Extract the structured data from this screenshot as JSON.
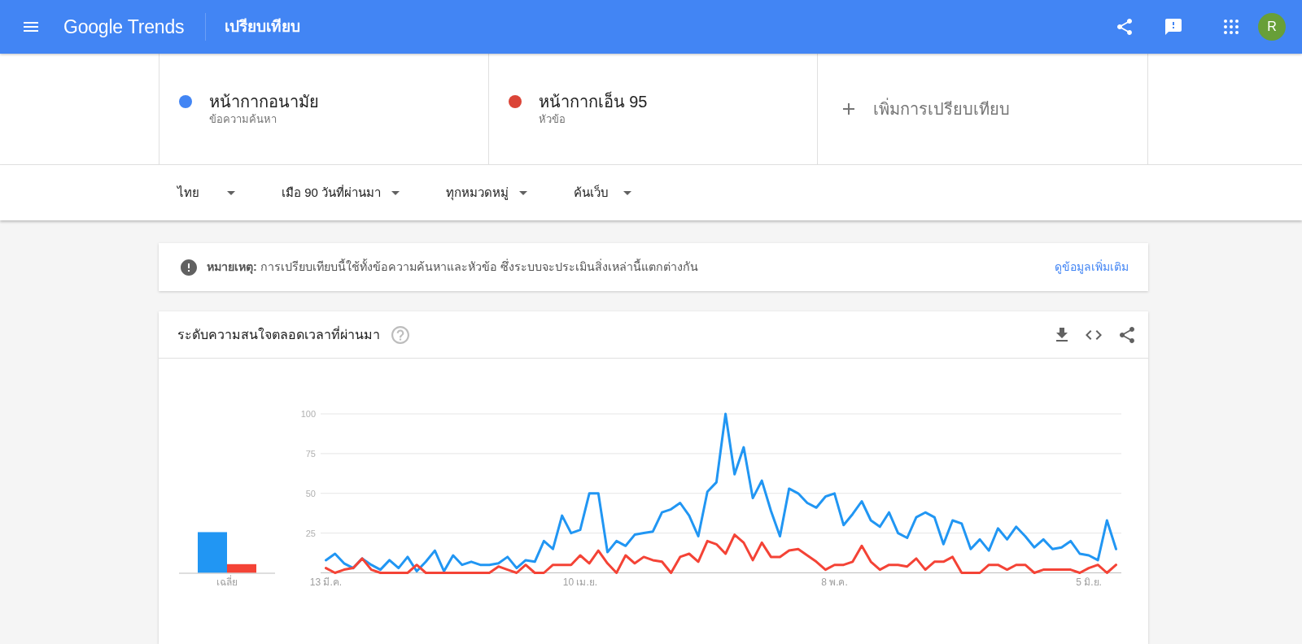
{
  "header": {
    "logo": "Google Trends",
    "title": "เปรียบเทียบ",
    "avatar_letter": "R"
  },
  "terms": [
    {
      "name": "หน้ากากอนามัย",
      "subtitle": "ข้อความค้นหา",
      "color": "#4285f4"
    },
    {
      "name": "หน้ากากเอ็น 95",
      "subtitle": "หัวข้อ",
      "color": "#db4437"
    }
  ],
  "add_comparison": "เพิ่มการเปรียบเทียบ",
  "filters": [
    "ไทย",
    "เมือ 90 วันที่ผ่านมา",
    "ทุกหมวดหมู่",
    "ค้นเว็บ"
  ],
  "note": {
    "text": "**หมายเหตุ:** การเปรียบเทียบนี้ใช้ทั้งข้อความค้นหาและหัวข้อ ซึ่งระบบจะประเมินสิ่งเหล่านี้แตกต่างกัน",
    "link": "ดูข้อมูลเพิ่มเติม"
  },
  "interest_over_time": {
    "title": "ระดับความสนใจตลอดเวลาที่ผ่านมา",
    "average_label": "เฉลี่ย",
    "chart_data": {
      "type": "line",
      "grid": true,
      "categories": [
        "13 มี.ค.",
        null,
        null,
        null,
        null,
        null,
        null,
        null,
        null,
        null,
        null,
        null,
        null,
        null,
        null,
        null,
        null,
        null,
        null,
        null,
        null,
        null,
        null,
        null,
        null,
        null,
        null,
        null,
        "10 เม.ย.",
        null,
        null,
        null,
        null,
        null,
        null,
        null,
        null,
        null,
        null,
        null,
        null,
        null,
        null,
        null,
        null,
        null,
        null,
        null,
        null,
        null,
        null,
        null,
        null,
        null,
        null,
        null,
        "8 พ.ค.",
        null,
        null,
        null,
        null,
        null,
        null,
        null,
        null,
        null,
        null,
        null,
        null,
        null,
        null,
        null,
        null,
        null,
        null,
        null,
        null,
        null,
        null,
        null,
        null,
        null,
        null,
        null,
        "5 มิ.ย.",
        null,
        null,
        null
      ],
      "ylim": [
        0,
        100
      ],
      "yticks": [
        25,
        50,
        75,
        100
      ],
      "series": [
        {
          "color": "#2196f3",
          "values": [
            8,
            12,
            6,
            3,
            9,
            5,
            2,
            8,
            3,
            10,
            1,
            7,
            14,
            1,
            11,
            5,
            7,
            5,
            5,
            6,
            10,
            3,
            8,
            7,
            20,
            15,
            36,
            25,
            27,
            50,
            50,
            13,
            20,
            17,
            24,
            25,
            26,
            38,
            40,
            44,
            36,
            23,
            51,
            57,
            100,
            62,
            79,
            47,
            58,
            39,
            23,
            53,
            50,
            44,
            41,
            48,
            50,
            30,
            37,
            45,
            33,
            29,
            38,
            25,
            22,
            35,
            38,
            35,
            18,
            33,
            31,
            15,
            21,
            14,
            28,
            21,
            29,
            23,
            16,
            21,
            15,
            16,
            20,
            12,
            11,
            8,
            33,
            15
          ]
        },
        {
          "color": "#f44336",
          "values": [
            3,
            0,
            2,
            3,
            9,
            2,
            0,
            0,
            0,
            0,
            5,
            0,
            0,
            0,
            0,
            0,
            0,
            0,
            0,
            4,
            2,
            0,
            5,
            0,
            0,
            5,
            5,
            5,
            11,
            6,
            14,
            6,
            0,
            11,
            6,
            10,
            8,
            7,
            0,
            10,
            12,
            7,
            20,
            18,
            12,
            24,
            19,
            8,
            19,
            10,
            10,
            14,
            15,
            11,
            7,
            2,
            5,
            5,
            7,
            17,
            7,
            2,
            5,
            5,
            4,
            9,
            2,
            7,
            7,
            10,
            0,
            0,
            0,
            5,
            5,
            2,
            5,
            5,
            0,
            2,
            2,
            2,
            2,
            0,
            3,
            5,
            0,
            5
          ]
        }
      ]
    }
  }
}
